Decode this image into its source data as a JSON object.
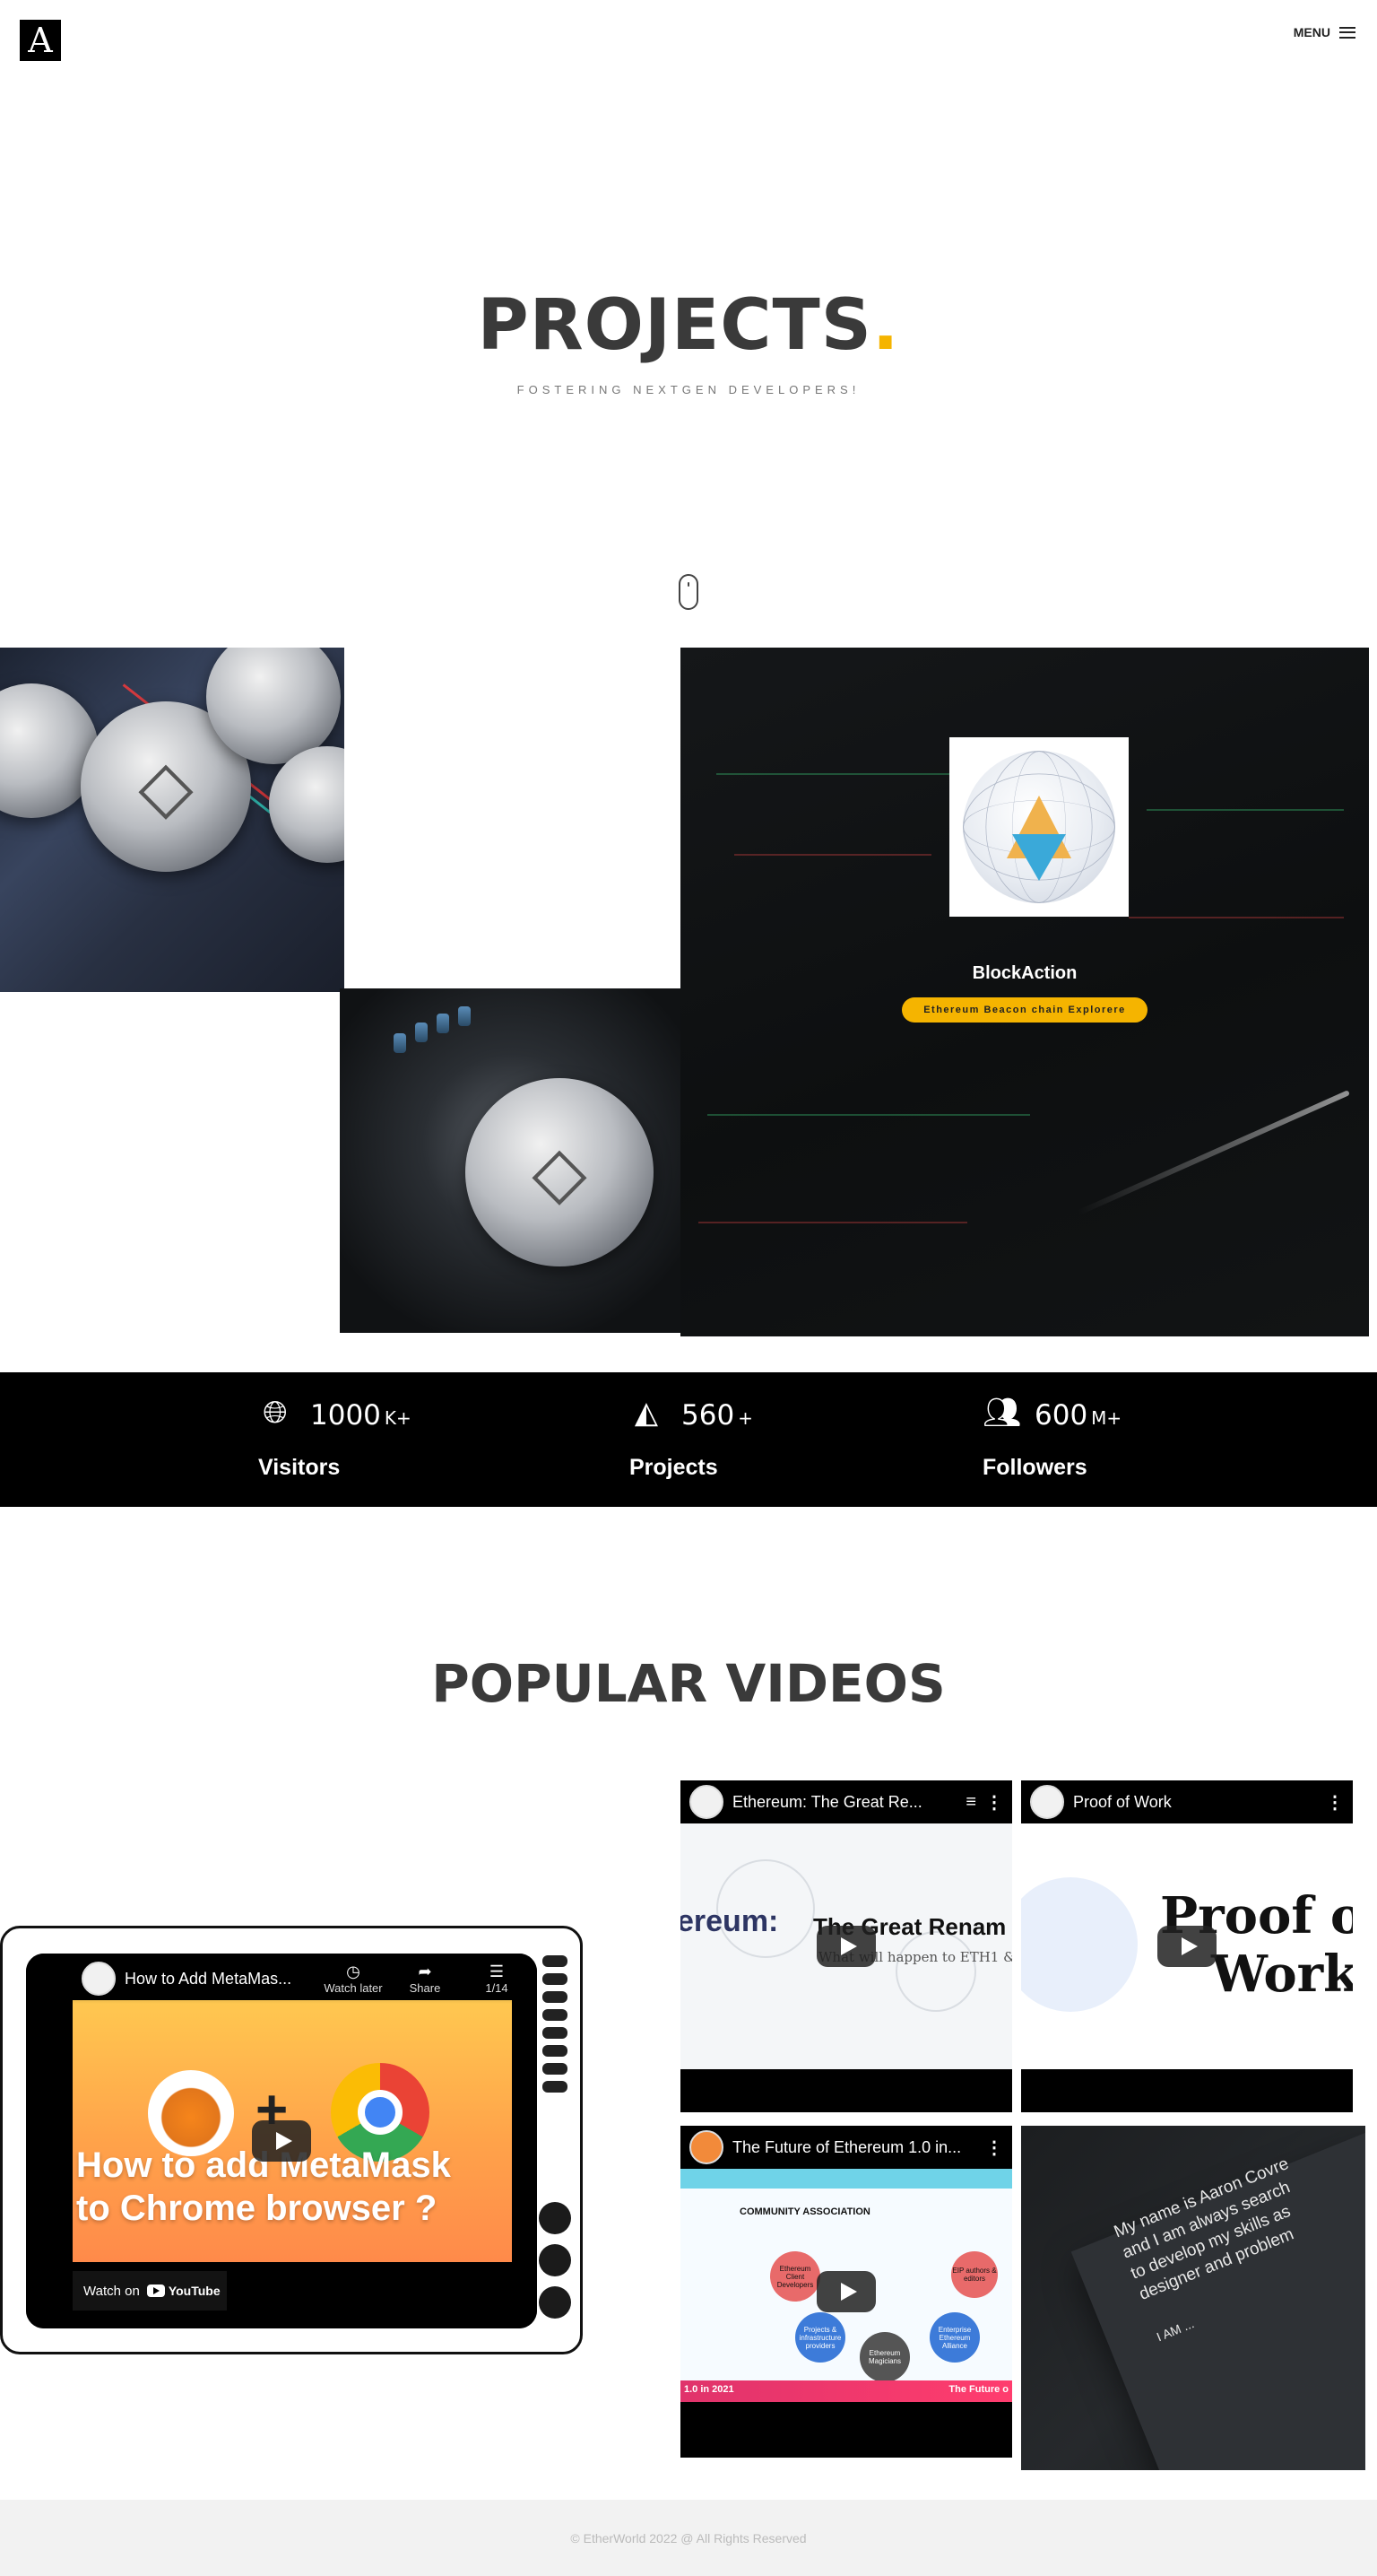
{
  "header": {
    "logo_letter": "A",
    "menu_label": "MENU"
  },
  "hero": {
    "title": "PROJECTS",
    "title_dot": ".",
    "subtitle": "FOSTERING NEXTGEN DEVELOPERS!"
  },
  "project": {
    "name": "BlockAction",
    "tagline": "Ethereum Beacon chain Explorere"
  },
  "stats": [
    {
      "icon": "globe-icon",
      "value": "1000",
      "suffix": "K+",
      "label": "Visitors"
    },
    {
      "icon": "prism-icon",
      "value": "560",
      "suffix": "+",
      "label": "Projects"
    },
    {
      "icon": "users-icon",
      "value": "600",
      "suffix": "M+",
      "label": "Followers"
    }
  ],
  "videos": {
    "section_title": "POPULAR VIDEOS",
    "featured": {
      "title": "How to Add MetaMas...",
      "controls": [
        "Watch later",
        "Share",
        "1/14"
      ],
      "thumb_text": [
        "How to add MetaMask",
        "to Chrome browser ?"
      ],
      "watch_on": "Watch on",
      "youtube": "YouTube"
    },
    "grid": [
      {
        "title": "Ethereum: The Great Re...",
        "thumb_big": "ereum:",
        "thumb_big2": "The Great Renam",
        "thumb_small": "What will happen to ETH1 &"
      },
      {
        "title": "Proof of Work",
        "thumb_big": "Proof  o",
        "thumb_big2": "Work"
      },
      {
        "title": "The Future of Ethereum 1.0 in...",
        "community_title": "COMMUNITY ASSOCIATION",
        "bubbles": [
          "Ethereum Client Developers",
          "EIP authors & editors",
          "Projects & infrastructure providers",
          "Enterprise Ethereum Alliance",
          "Ethereum Magicians"
        ],
        "band_left": "1.0 in 2021",
        "band_right": "The Future o"
      }
    ],
    "letter": {
      "lines": [
        "My name is Aaron Covre",
        "and I am always search",
        "to develop my skills as",
        "designer and problem",
        "I AM ..."
      ]
    }
  },
  "footer": {
    "copyright": "© EtherWorld 2022 @ All Rights Reserved"
  },
  "colors": {
    "accent": "#f5b400",
    "dark": "#000000",
    "footer_bg": "#f2f2f2"
  }
}
